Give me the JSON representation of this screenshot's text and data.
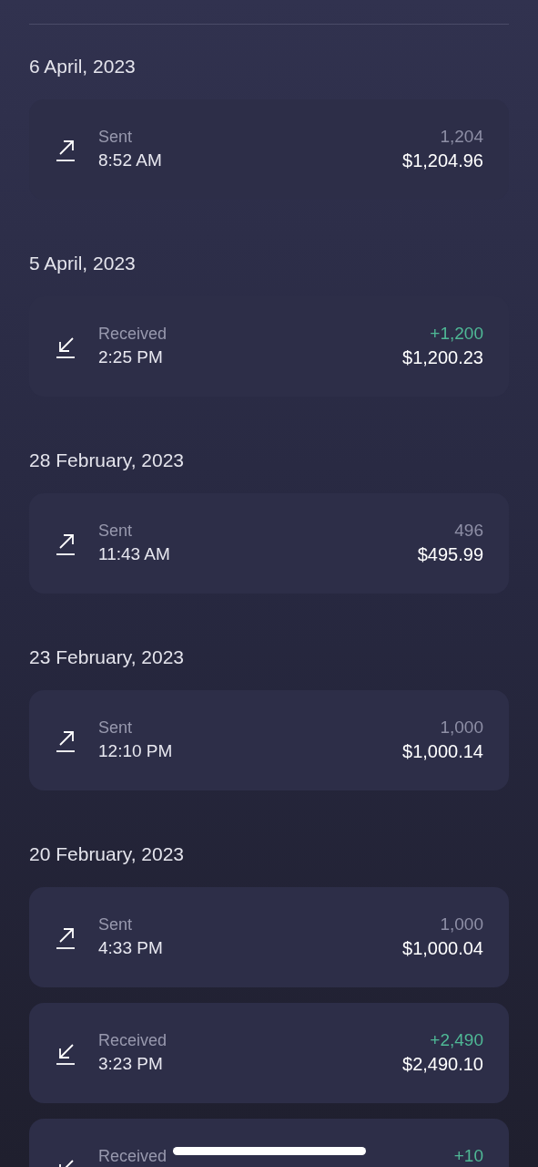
{
  "groups": [
    {
      "date": "6 April, 2023",
      "transactions": [
        {
          "kind": "sent",
          "label": "Sent",
          "time": "8:52 AM",
          "amount": "1,204",
          "value": "$1,204.96"
        }
      ]
    },
    {
      "date": "5 April, 2023",
      "transactions": [
        {
          "kind": "received",
          "label": "Received",
          "time": "2:25 PM",
          "amount": "+1,200",
          "value": "$1,200.23"
        }
      ]
    },
    {
      "date": "28 February, 2023",
      "transactions": [
        {
          "kind": "sent",
          "label": "Sent",
          "time": "11:43 AM",
          "amount": "496",
          "value": "$495.99"
        }
      ]
    },
    {
      "date": "23 February, 2023",
      "transactions": [
        {
          "kind": "sent",
          "label": "Sent",
          "time": "12:10 PM",
          "amount": "1,000",
          "value": "$1,000.14"
        }
      ]
    },
    {
      "date": "20 February, 2023",
      "transactions": [
        {
          "kind": "sent",
          "label": "Sent",
          "time": "4:33 PM",
          "amount": "1,000",
          "value": "$1,000.04"
        },
        {
          "kind": "received",
          "label": "Received",
          "time": "3:23 PM",
          "amount": "+2,490",
          "value": "$2,490.10"
        },
        {
          "kind": "received",
          "label": "Received",
          "amount": "+10"
        }
      ]
    }
  ]
}
